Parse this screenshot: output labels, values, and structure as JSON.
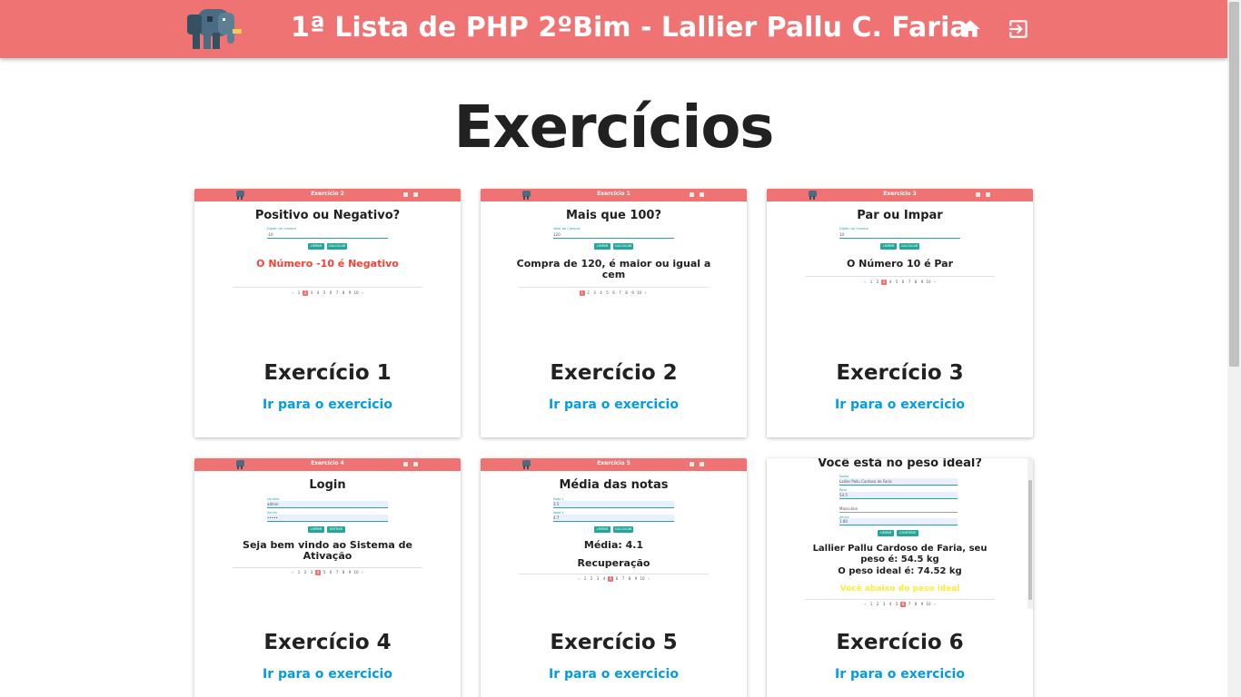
{
  "header": {
    "title": "1ª Lista de PHP 2ºBim - Lallier Pallu C. Faria",
    "logo_icon": "elephant-logo-icon",
    "home_icon": "home-icon",
    "logout_icon": "logout-icon",
    "background_color": "#ef7373"
  },
  "page": {
    "title": "Exercícios"
  },
  "link_color": "#039be5",
  "accent_teal": "#26a69a",
  "cards": [
    {
      "title": "Exercício 1",
      "link": "Ir para o exercicio",
      "thumb": {
        "bar_title": "Exercício 2",
        "heading": "Positivo ou Negativo?",
        "label": "Digite um número",
        "input_value": "-10",
        "buttons": [
          "LIMPAR",
          "CALCULAR"
        ],
        "result": "O Número -10 é Negativo",
        "result_color": "#f44336",
        "pager": [
          "‹",
          "1",
          "2",
          "3",
          "4",
          "5",
          "6",
          "7",
          "8",
          "9",
          "10",
          "›"
        ],
        "active_page": "2"
      }
    },
    {
      "title": "Exercício 2",
      "link": "Ir para o exercicio",
      "thumb": {
        "bar_title": "Exercício 1",
        "heading": "Mais que 100?",
        "label": "Valor da Compra",
        "input_value": "120",
        "buttons": [
          "LIMPAR",
          "CALCULAR"
        ],
        "result": "Compra de 120, é maior ou igual a cem",
        "result_color": "#212121",
        "pager": [
          "1",
          "2",
          "3",
          "4",
          "5",
          "6",
          "7",
          "8",
          "9",
          "10",
          "›"
        ],
        "active_page": "1"
      }
    },
    {
      "title": "Exercício 3",
      "link": "Ir para o exercicio",
      "thumb": {
        "bar_title": "Exercício 3",
        "heading": "Par ou Impar",
        "label": "Digite um número",
        "input_value": "10",
        "buttons": [
          "LIMPAR",
          "CALCULAR"
        ],
        "result": "O Número 10 é Par",
        "result_color": "#212121",
        "pager": [
          "‹",
          "1",
          "2",
          "3",
          "4",
          "5",
          "6",
          "7",
          "8",
          "9",
          "10",
          "›"
        ],
        "active_page": "3"
      }
    },
    {
      "title": "Exercício 4",
      "link": "Ir para o exercicio",
      "thumb": {
        "bar_title": "Exercício 4",
        "heading": "Login",
        "label": "Usuário",
        "input_value": "admin",
        "label2": "Senha",
        "input2_value": "•••••",
        "buttons": [
          "LIMPAR",
          "ENTRAR"
        ],
        "result": "Seja bem vindo ao Sistema de Ativação",
        "result_color": "#212121",
        "pager": [
          "‹",
          "1",
          "2",
          "3",
          "4",
          "5",
          "6",
          "7",
          "8",
          "9",
          "10",
          "›"
        ],
        "active_page": "4"
      }
    },
    {
      "title": "Exercício 5",
      "link": "Ir para o exercicio",
      "thumb": {
        "bar_title": "Exercício 5",
        "heading": "Média das notas",
        "label": "Nota 1",
        "input_value": "3.5",
        "label2": "Nota 2",
        "input2_value": "4.7",
        "buttons": [
          "LIMPAR",
          "CALCULAR"
        ],
        "result": "Média: 4.1",
        "result2": "Recuperação",
        "result_color": "#212121",
        "pager": [
          "‹",
          "1",
          "2",
          "3",
          "4",
          "5",
          "6",
          "7",
          "8",
          "9",
          "10",
          "›"
        ],
        "active_page": "5"
      }
    },
    {
      "title": "Exercício 6",
      "link": "Ir para o exercicio",
      "thumb": {
        "heading": "Você está no peso ideal?",
        "label": "Nome",
        "input_value": "Lallier Pallu Cardoso de Faria",
        "label2": "Peso",
        "input2_value": "54.5",
        "select_value": "Masculino",
        "label3": "Altura",
        "input3_value": "1.80",
        "buttons": [
          "LIMPAR",
          "CONFERIR"
        ],
        "result": "Lallier Pallu Cardoso de Faria, seu peso é: 54.5 kg",
        "result2": "O peso ideal é: 74.52 kg",
        "warning": "Você abaixo do peso ideal",
        "warning_color": "#ffeb3b",
        "result_color": "#212121",
        "pager": [
          "‹",
          "1",
          "2",
          "3",
          "4",
          "5",
          "6",
          "7",
          "8",
          "9",
          "10",
          "›"
        ],
        "active_page": "6"
      }
    }
  ]
}
